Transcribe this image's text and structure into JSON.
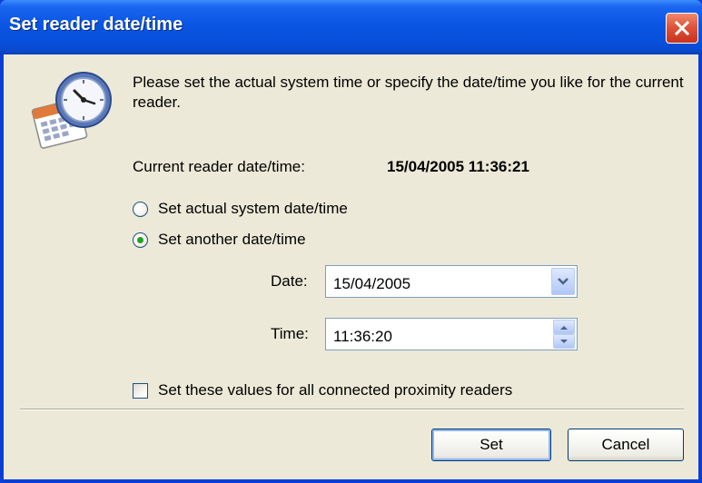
{
  "window": {
    "title": "Set reader date/time"
  },
  "icons": {
    "app": "clock-calendar-icon",
    "close": "close-icon"
  },
  "intro_text": "Please set the actual system time or specify the date/time you like for the current reader.",
  "current_reader": {
    "label": "Current reader date/time:",
    "value": "15/04/2005 11:36:21"
  },
  "options": {
    "actual": {
      "label": "Set actual system date/time",
      "selected": false
    },
    "another": {
      "label": "Set another date/time",
      "selected": true
    }
  },
  "date_field": {
    "label": "Date:",
    "value": "15/04/2005"
  },
  "time_field": {
    "label": "Time:",
    "value": "11:36:20"
  },
  "all_readers_checkbox": {
    "label": "Set these values for all connected proximity readers",
    "checked": false
  },
  "buttons": {
    "set": "Set",
    "cancel": "Cancel"
  },
  "colors": {
    "title_bar": "#0a55e4",
    "face": "#ece9d8",
    "close": "#e0543a",
    "radio_dot": "#21a121"
  }
}
